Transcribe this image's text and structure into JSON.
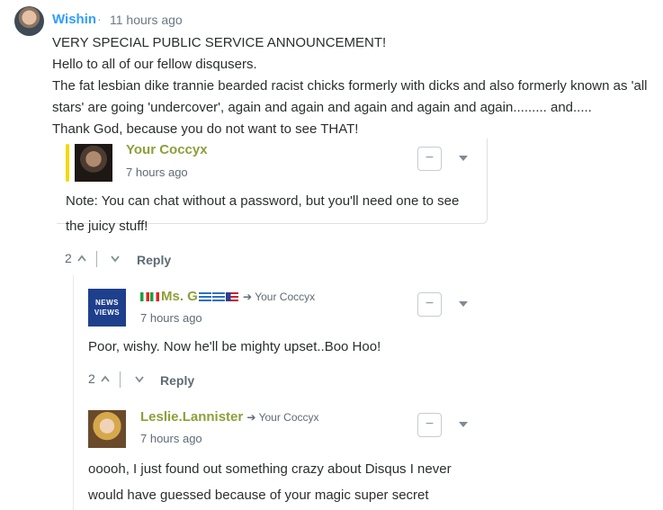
{
  "top_comment": {
    "author": "Wishin",
    "separator": "·",
    "time": "11 hours ago",
    "lines": [
      "VERY SPECIAL PUBLIC SERVICE ANNOUNCEMENT!",
      "Hello to all of our fellow disqusers.",
      "The fat lesbian dike trannie bearded racist chicks formerly with dicks and also formerly known as 'all",
      "stars' are going 'undercover', again and again and again and again and again......... and.....",
      "Thank God, because you do not want to see THAT!"
    ]
  },
  "reply_1": {
    "author": "Your Coccyx",
    "time": "7 hours ago",
    "lines": [
      "Note: You can chat without a password, but you'll need one to see",
      "the juicy stuff!"
    ],
    "votes": "2",
    "reply_label": "Reply",
    "collapse_label": "−"
  },
  "reply_2": {
    "author": "Ms. G",
    "reply_to": "Your Coccyx",
    "time": "7 hours ago",
    "avatar_text": [
      "NEWS",
      "VIEWS"
    ],
    "text": "Poor, wishy. Now he'll be mighty upset..Boo Hoo!",
    "votes": "2",
    "reply_label": "Reply",
    "collapse_label": "−"
  },
  "reply_3": {
    "author": "Leslie.Lannister",
    "reply_to": "Your Coccyx",
    "time": "7 hours ago",
    "lines": [
      "ooooh, I just found out something crazy about Disqus I never",
      "would have guessed because of your magic super secret"
    ],
    "collapse_label": "−"
  },
  "colors": {
    "link_blue": "#2e9fff",
    "author_olive": "#8e9f3a",
    "highlight_yellow": "#f5d800",
    "news_avatar_bg": "#1e3f8c"
  }
}
